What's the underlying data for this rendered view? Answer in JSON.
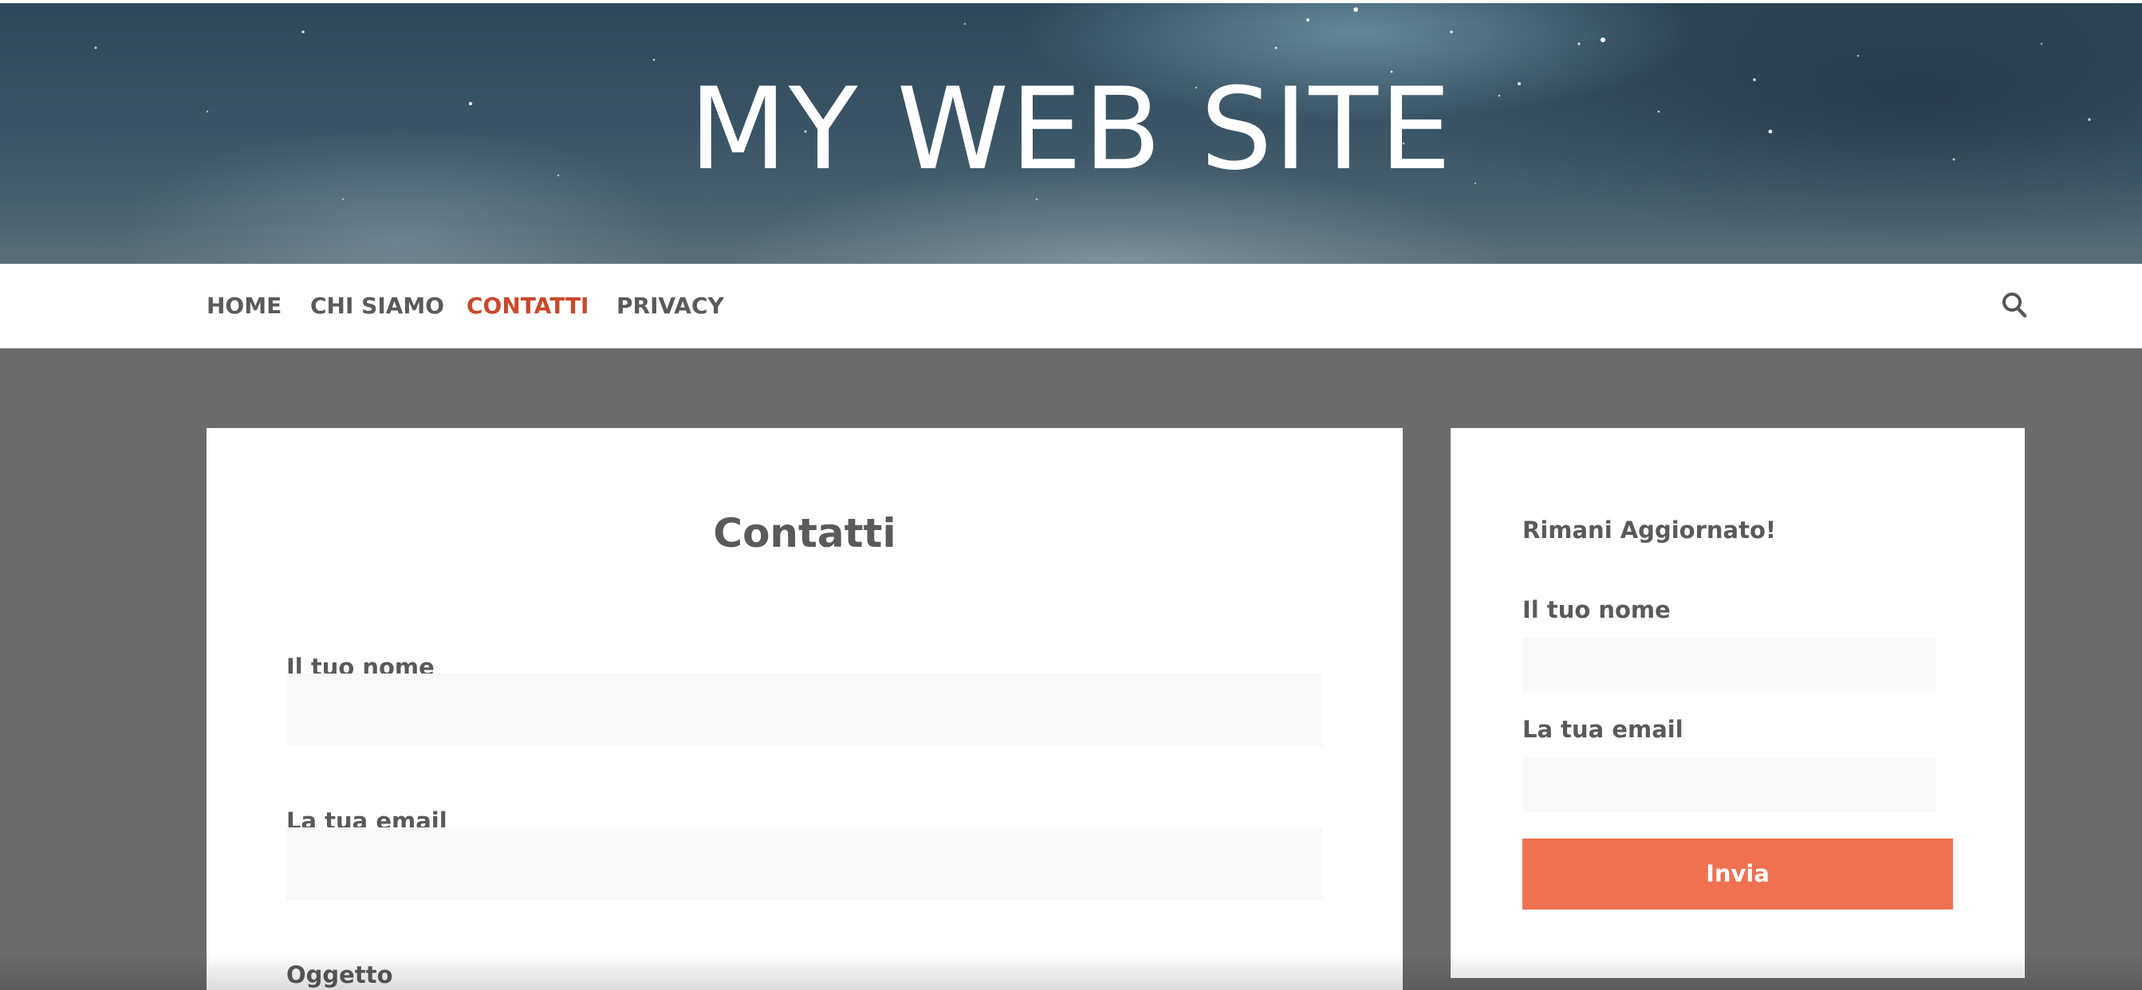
{
  "header": {
    "site_title": "MY WEB SITE"
  },
  "nav": {
    "items": [
      {
        "label": "HOME",
        "active": false
      },
      {
        "label": "CHI SIAMO",
        "active": false
      },
      {
        "label": "CONTATTI",
        "active": true
      },
      {
        "label": "PRIVACY",
        "active": false
      }
    ],
    "search_icon": "search-icon"
  },
  "main": {
    "title": "Contatti",
    "fields": [
      {
        "label": "Il tuo nome",
        "value": ""
      },
      {
        "label": "La tua email",
        "value": ""
      },
      {
        "label": "Oggetto",
        "value": ""
      }
    ]
  },
  "sidebar": {
    "heading": "Rimani Aggiornato!",
    "fields": [
      {
        "label": "Il tuo nome",
        "value": ""
      },
      {
        "label": "La tua email",
        "value": ""
      }
    ],
    "submit_label": "Invia"
  },
  "colors": {
    "accent": "#c8492c",
    "button": "#ef7150",
    "page_background": "#6b6b6b",
    "text": "#5a5a5a"
  }
}
